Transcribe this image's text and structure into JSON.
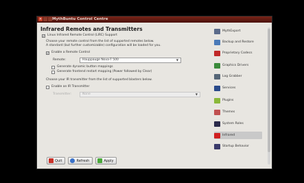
{
  "window": {
    "title": "MythBuntu Control Centre"
  },
  "main": {
    "heading": "Infrared Remotes and Transmitters",
    "lirc_support_label": "Linux Infrared Remote Control (LIRC) Support",
    "description_line1": "Choose your remote control from the list of supported remotes below.",
    "description_line2": "A standard (but further customizable) configuration will be loaded for you.",
    "enable_remote_label": "Enable a Remote Control",
    "remote_label": "Remote:",
    "remote_value": "Hauppauge Nova-T 500",
    "generate_mappings_label": "Generate dynamic button mappings",
    "generate_frontend_label": "Generate frontend restart mapping (Power followed by Clear)",
    "transmitter_description": "Choose your IR transmitter from the list of supported blasters below.",
    "enable_transmitter_label": "Enable an IR Transmitter",
    "transmitter_label": "Transmitter:",
    "transmitter_value": "None"
  },
  "buttons": {
    "quit": "Quit",
    "refresh": "Refresh",
    "apply": "Apply"
  },
  "sidebar": {
    "items": [
      {
        "label": "MythExport",
        "icon": "mythexport-icon",
        "color": "#5a6a8a"
      },
      {
        "label": "Backup and Restore",
        "icon": "backup-icon",
        "color": "#4a7ab8"
      },
      {
        "label": "Proprietary Codecs",
        "icon": "codecs-icon",
        "color": "#c02828"
      },
      {
        "label": "Graphics Drivers",
        "icon": "graphics-icon",
        "color": "#3a8a3a"
      },
      {
        "label": "Log Grabber",
        "icon": "magnifier-icon",
        "color": "#556677"
      },
      {
        "label": "Services",
        "icon": "services-icon",
        "color": "#2a4a8a"
      },
      {
        "label": "Plugins",
        "icon": "plugins-icon",
        "color": "#8ab83a"
      },
      {
        "label": "Themes",
        "icon": "themes-icon",
        "color": "#c05050"
      },
      {
        "label": "System Roles",
        "icon": "system-roles-icon",
        "color": "#2a2a4a"
      },
      {
        "label": "Infrared",
        "icon": "infrared-icon",
        "color": "#d02020"
      },
      {
        "label": "Startup Behavior",
        "icon": "startup-icon",
        "color": "#3a3a6a"
      }
    ]
  }
}
